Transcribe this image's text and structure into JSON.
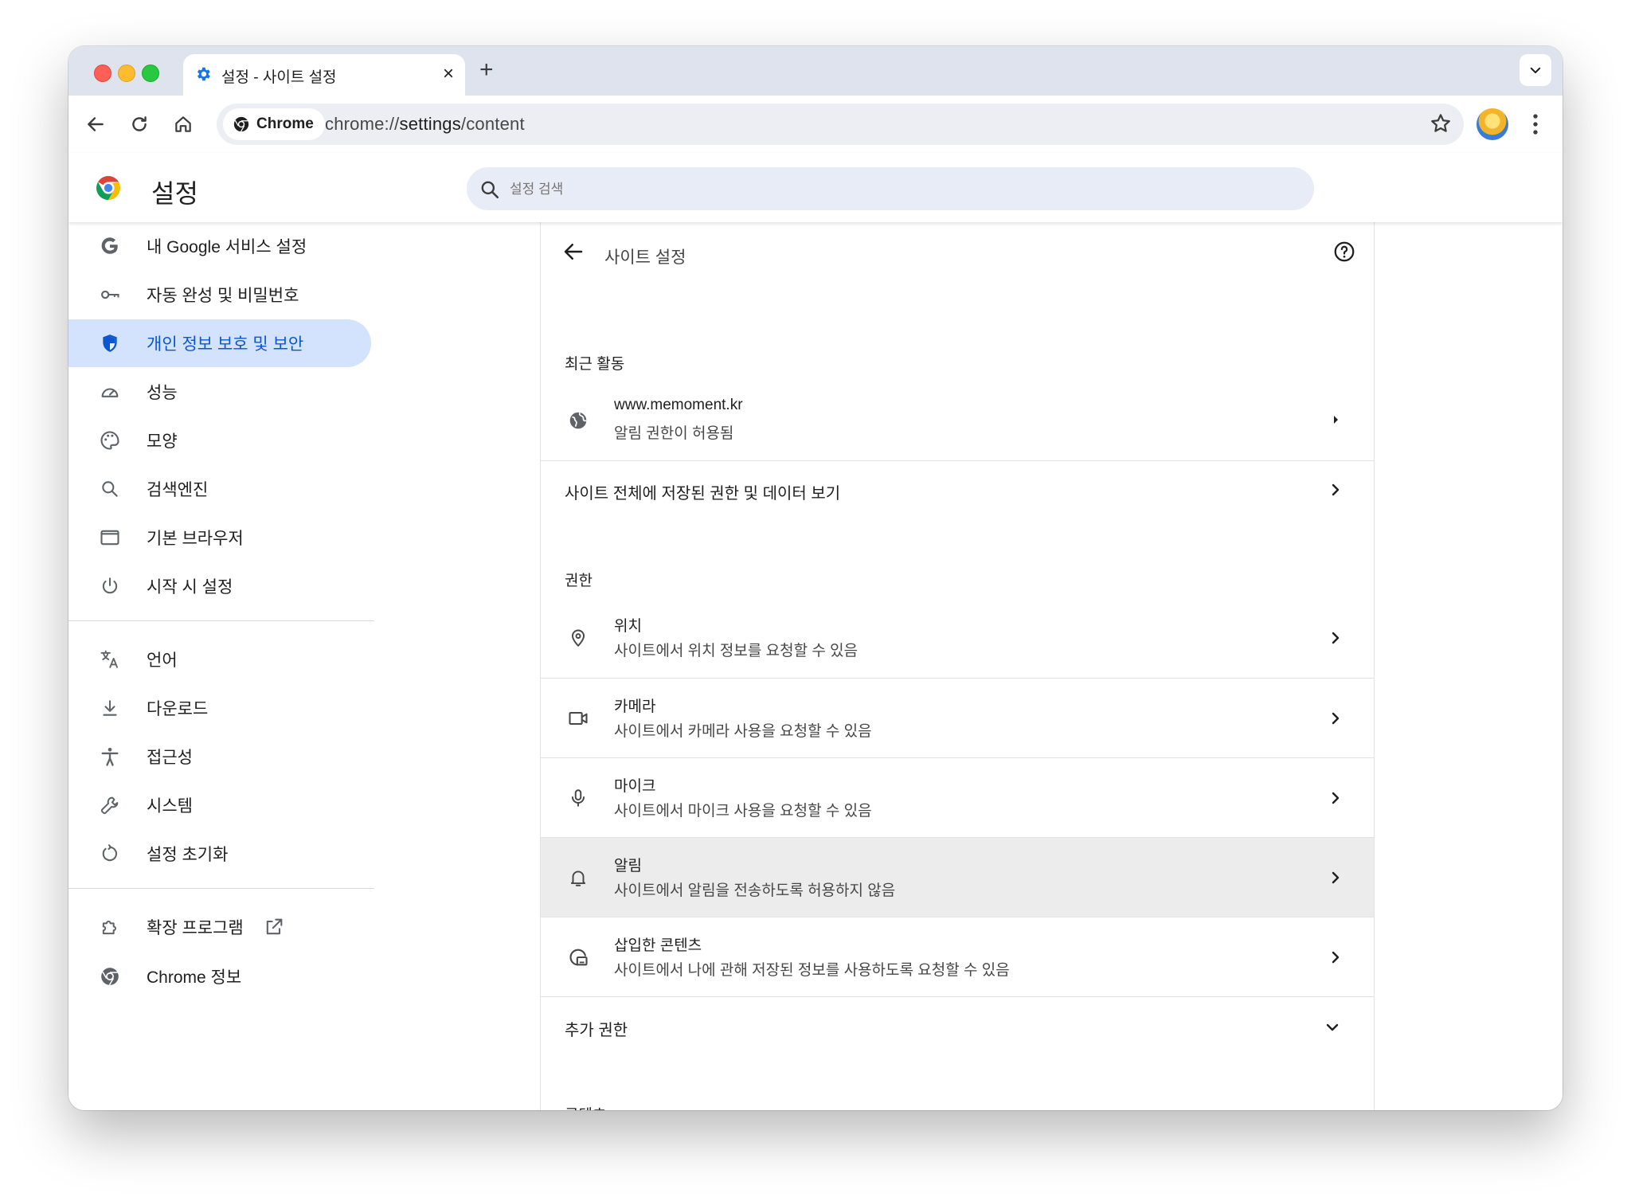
{
  "tab": {
    "title": "설정 - 사이트 설정",
    "close": "×",
    "new_tab": "+"
  },
  "toolbar": {
    "chip_label": "Chrome",
    "url_scheme": "chrome://",
    "url_host": "settings",
    "url_path": "/content"
  },
  "header": {
    "title": "설정",
    "search_placeholder": "설정 검색"
  },
  "sidebar": {
    "items": [
      {
        "label": "내 Google 서비스 설정",
        "icon": "google-g-icon"
      },
      {
        "label": "자동 완성 및 비밀번호",
        "icon": "key-icon"
      },
      {
        "label": "개인 정보 보호 및 보안",
        "icon": "shield-icon",
        "active": true
      },
      {
        "label": "성능",
        "icon": "speedometer-icon"
      },
      {
        "label": "모양",
        "icon": "palette-icon"
      },
      {
        "label": "검색엔진",
        "icon": "search-icon"
      },
      {
        "label": "기본 브라우저",
        "icon": "browser-window-icon"
      },
      {
        "label": "시작 시 설정",
        "icon": "power-icon"
      },
      {
        "label": "언어",
        "icon": "translate-icon"
      },
      {
        "label": "다운로드",
        "icon": "download-icon"
      },
      {
        "label": "접근성",
        "icon": "accessibility-icon"
      },
      {
        "label": "시스템",
        "icon": "wrench-icon"
      },
      {
        "label": "설정 초기화",
        "icon": "reset-icon"
      },
      {
        "label": "확장 프로그램",
        "icon": "puzzle-icon"
      },
      {
        "label": "Chrome 정보",
        "icon": "chrome-icon"
      }
    ]
  },
  "page": {
    "title": "사이트 설정",
    "recent_label": "최근 활동",
    "recent": {
      "site": "www.memoment.kr",
      "detail": "알림 권한이 허용됨"
    },
    "all_sites_label": "사이트 전체에 저장된 권한 및 데이터 보기",
    "permissions_label": "권한",
    "permissions": [
      {
        "title": "위치",
        "desc": "사이트에서 위치 정보를 요청할 수 있음",
        "icon": "location-pin-icon"
      },
      {
        "title": "카메라",
        "desc": "사이트에서 카메라 사용을 요청할 수 있음",
        "icon": "camera-icon"
      },
      {
        "title": "마이크",
        "desc": "사이트에서 마이크 사용을 요청할 수 있음",
        "icon": "microphone-icon"
      },
      {
        "title": "알림",
        "desc": "사이트에서 알림을 전송하도록 허용하지 않음",
        "icon": "bell-icon"
      },
      {
        "title": "삽입한 콘텐츠",
        "desc": "사이트에서 나에 관해 저장된 정보를 사용하도록 요청할 수 있음",
        "icon": "embedded-content-icon"
      }
    ],
    "more_permissions_label": "추가 권한",
    "content_label_cut": "콘텐츠"
  },
  "colors": {
    "accent": "#0b57d0",
    "active_bg": "#d3e3fd",
    "highlight_row": "#ececec"
  }
}
